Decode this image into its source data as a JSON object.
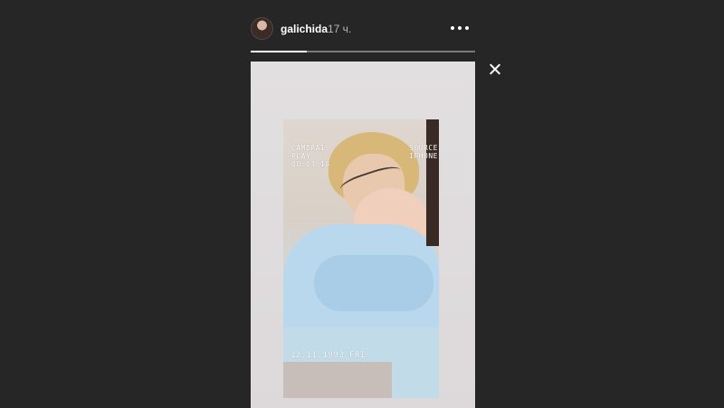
{
  "story": {
    "username": "galichida",
    "timestamp": "17 ч.",
    "progress": 0.25
  },
  "video_overlay": {
    "top_left": [
      "CAMERA1",
      "PLAY",
      "00:03:18"
    ],
    "top_right": [
      "SOURCE",
      "IPHONE"
    ],
    "date": "12.11.1993 FRI"
  },
  "icons": {
    "more": "more-options-icon",
    "close": "close-icon",
    "avatar": "avatar"
  }
}
